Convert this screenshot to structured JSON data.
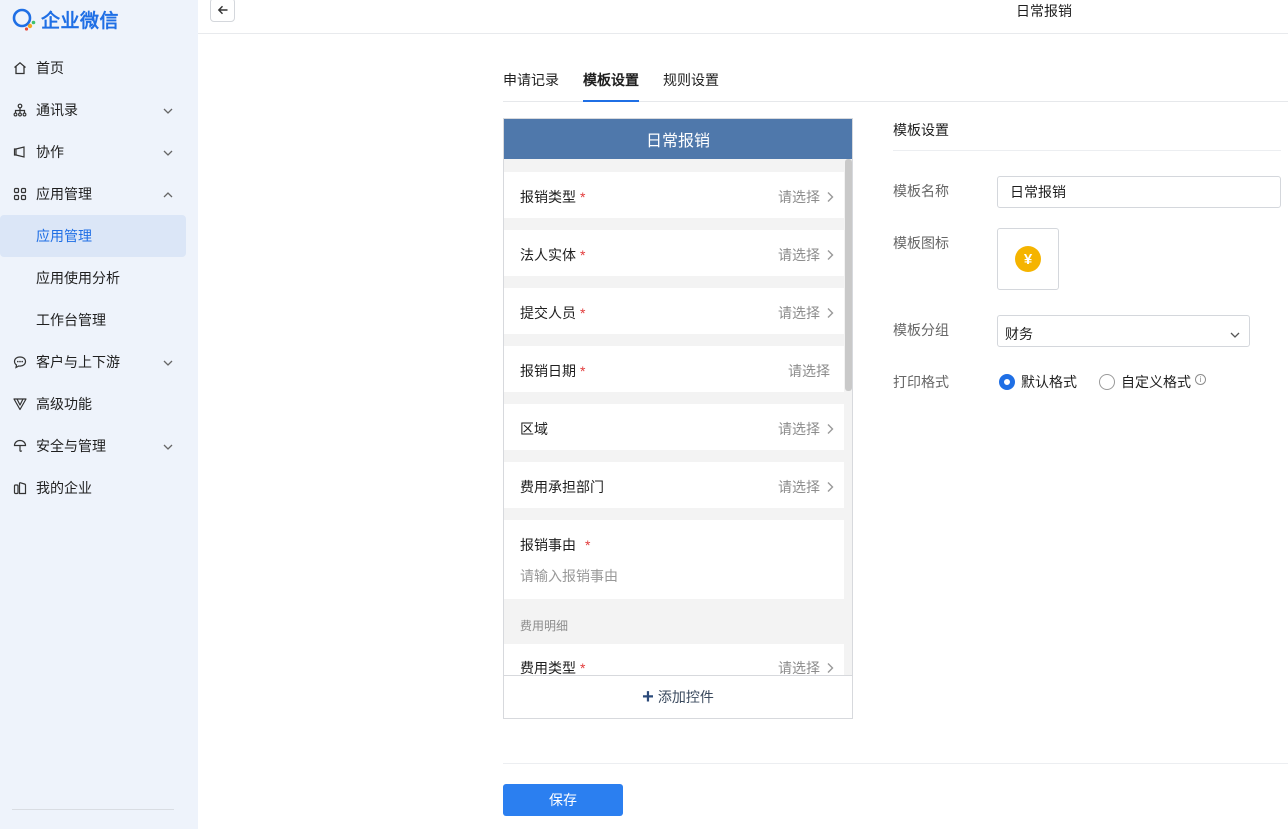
{
  "app": {
    "logo_text": "企业微信",
    "page_title": "日常报销"
  },
  "sidebar": {
    "items": [
      {
        "label": "首页"
      },
      {
        "label": "通讯录"
      },
      {
        "label": "协作"
      },
      {
        "label": "应用管理"
      },
      {
        "label": "应用管理"
      },
      {
        "label": "应用使用分析"
      },
      {
        "label": "工作台管理"
      },
      {
        "label": "客户与上下游"
      },
      {
        "label": "高级功能"
      },
      {
        "label": "安全与管理"
      },
      {
        "label": "我的企业"
      }
    ]
  },
  "tabs": [
    {
      "label": "申请记录"
    },
    {
      "label": "模板设置"
    },
    {
      "label": "规则设置"
    }
  ],
  "preview": {
    "header": "日常报销",
    "fields": [
      {
        "label": "报销类型",
        "value": "请选择"
      },
      {
        "label": "法人实体",
        "value": "请选择"
      },
      {
        "label": "提交人员",
        "value": "请选择"
      },
      {
        "label": "报销日期",
        "value": "请选择"
      },
      {
        "label": "区域",
        "value": "请选择"
      },
      {
        "label": "费用承担部门",
        "value": "请选择"
      },
      {
        "label": "报销事由",
        "placeholder": "请输入报销事由"
      },
      {
        "label": "费用类型",
        "value": "请选择"
      }
    ],
    "required_mark": "*",
    "section_label": "费用明细",
    "add_control": "添加控件"
  },
  "settings": {
    "title": "模板设置",
    "name_label": "模板名称",
    "name_value": "日常报销",
    "icon_label": "模板图标",
    "icon_glyph": "¥",
    "group_label": "模板分组",
    "group_value": "财务",
    "print_label": "打印格式",
    "print_options": [
      {
        "label": "默认格式",
        "checked": true
      },
      {
        "label": "自定义格式",
        "checked": false
      }
    ]
  },
  "footer": {
    "save_label": "保存"
  },
  "colors": {
    "accent": "#1f6fe5",
    "preview_header": "#4f78ab",
    "icon_yellow": "#f5b400",
    "required": "#e23b3b"
  }
}
